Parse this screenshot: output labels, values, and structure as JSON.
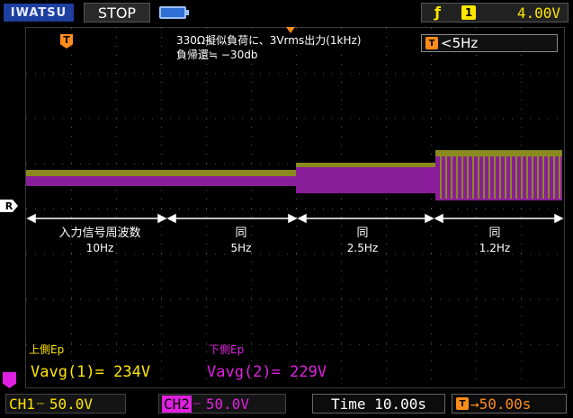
{
  "top_bar": {
    "brand": "IWATSU",
    "run_state": "STOP",
    "battery_icon": "battery-icon",
    "trigger_edge_icon": "rising-edge-icon",
    "trigger_source": "1",
    "trigger_level": "4.00V"
  },
  "markers": {
    "trigger_position": "T",
    "reference": "R"
  },
  "annotation": {
    "line1": "330Ω擬似負荷に、3Vrms出力(1kHz)",
    "line2": "負帰還≒ −30db"
  },
  "trigger_frequency": {
    "icon": "T",
    "value": "<5Hz"
  },
  "segments": [
    {
      "title": "入力信号周波数",
      "sub": "10Hz"
    },
    {
      "title": "同",
      "sub": "5Hz"
    },
    {
      "title": "同",
      "sub": "2.5Hz"
    },
    {
      "title": "同",
      "sub": "1.2Hz"
    }
  ],
  "measurements": {
    "upper_label": "上側Ep",
    "upper_value": "Vavg(1)= 234V",
    "lower_label": "下側Ep",
    "lower_value": "Vavg(2)= 229V"
  },
  "bottom_bar": {
    "ch1_name": "CH1",
    "ch1_coupling": "DC",
    "ch1_scale": "50.0V",
    "ch2_name": "CH2",
    "ch2_coupling": "DC",
    "ch2_scale": "50.0V",
    "timebase": "Time 10.00s",
    "horizontal_position": "50.00s",
    "position_icon": "T"
  },
  "colors": {
    "ch1": "#ffe600",
    "ch2": "#e020e0",
    "trace1": "#8a8a1e",
    "trace2": "#8a1e9a",
    "trigger": "#ff8c1a",
    "brand_bg": "#1d3fa0"
  }
}
